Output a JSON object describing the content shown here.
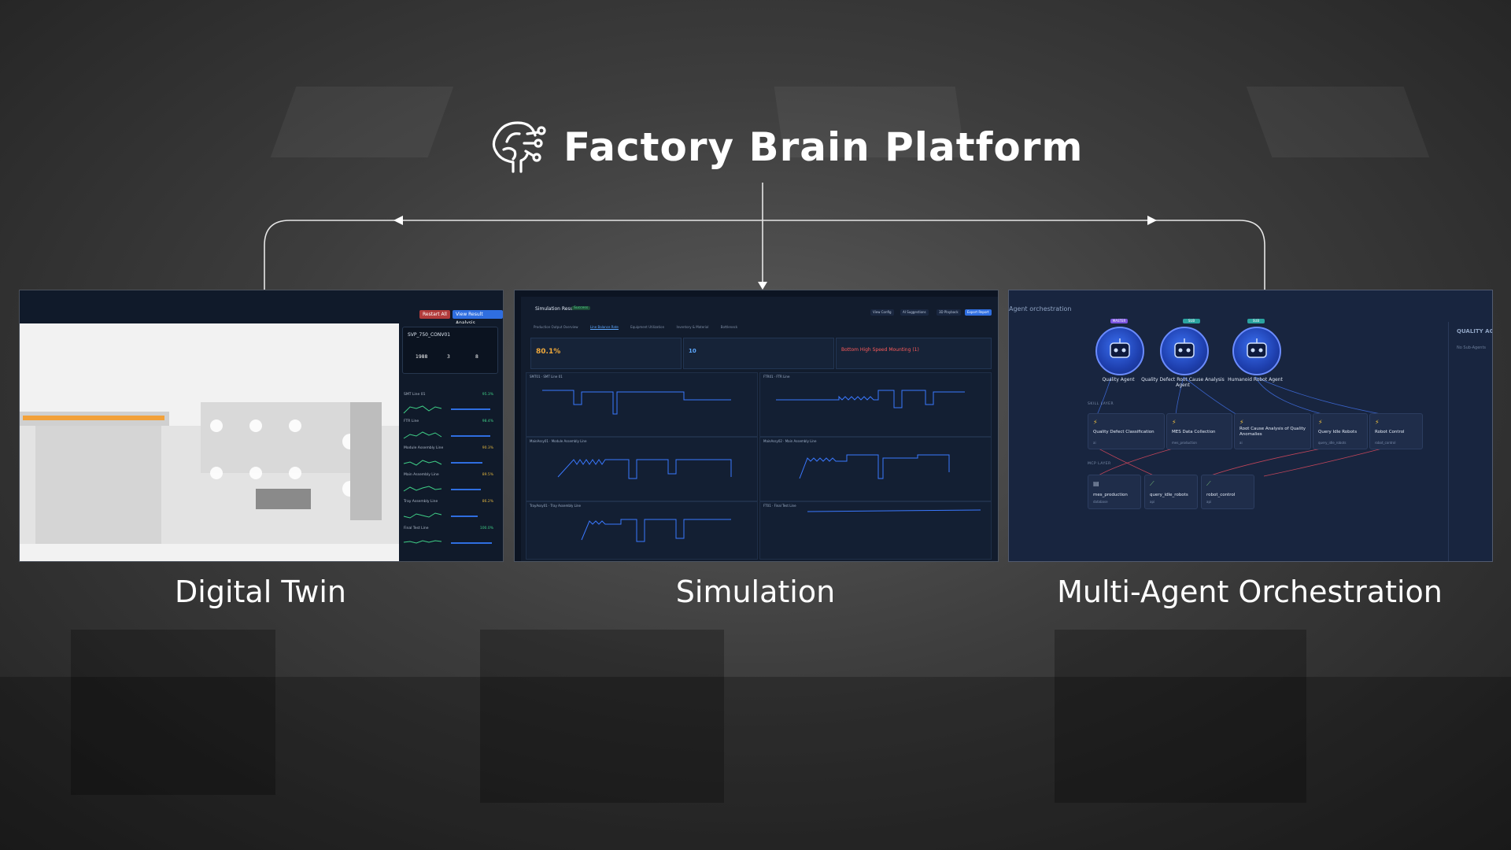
{
  "page": {
    "title": "Factory Brain Platform"
  },
  "panels": {
    "twin": {
      "label": "Digital Twin",
      "station": "SVP_750_CONV01",
      "card_values": [
        "1988",
        "3",
        "8"
      ],
      "lines": [
        {
          "name": "SMT Line 01",
          "pct": "95.3%",
          "status_color": "#3fcf87"
        },
        {
          "name": "FTR Line",
          "pct": "98.4%",
          "status_color": "#3fcf87"
        },
        {
          "name": "Module Assembly Line",
          "pct": "90.3%",
          "status_color": "#e0b43f"
        },
        {
          "name": "Main Assembly Line",
          "pct": "89.5%",
          "status_color": "#e0b43f"
        },
        {
          "name": "Tray Assembly Line",
          "pct": "86.2%",
          "status_color": "#e0b43f"
        },
        {
          "name": "Final Test Line",
          "pct": "100.0%",
          "status_color": "#3fcf87"
        }
      ],
      "topbar": {
        "restart": "Restart All",
        "view": "View Result Analysis"
      }
    },
    "sim": {
      "label": "Simulation",
      "result_title": "Simulation Result",
      "status": "Success",
      "tabs": [
        "Production Output Overview",
        "Line Balance Rate",
        "Equipment Utilization",
        "Inventory & Material",
        "Bottleneck"
      ],
      "kpi_value": "80.1%",
      "kpi_secondary": "10",
      "alert": "Bottom High Speed Mounting (1)",
      "buttons": [
        "View Config",
        "AI Suggestions",
        "3D Playback",
        "Export Report"
      ],
      "charts": [
        "SMT01 · SMT Line 01",
        "FTR01 · FTR Line",
        "MainAssy01 · Module Assembly Line",
        "MainAssy02 · Main Assembly Line",
        "TrayAssy01 · Tray Assembly Line",
        "FT01 · Final Test Line"
      ]
    },
    "agent": {
      "label": "Multi-Agent Orchestration",
      "header": "Agent orchestration",
      "right_column": "QUALITY AGENT",
      "right_column_sub": "No Sub-Agents",
      "agents": [
        {
          "name": "Quality Agent",
          "badge": "MASTER",
          "badge_color": "#7b55e0"
        },
        {
          "name": "Quality Defect Root Cause Analysis Agent",
          "badge": "SUB",
          "badge_color": "#2ba3a0"
        },
        {
          "name": "Humanoid Robot Agent",
          "badge": "SUB",
          "badge_color": "#2ba3a0"
        }
      ],
      "skill_label": "SKILL LAYER",
      "skills": [
        {
          "title": "Quality Defect Classification",
          "sub": "ai"
        },
        {
          "title": "MES Data Collection",
          "sub": "mes_production"
        },
        {
          "title": "Root Cause Analysis of Quality Anomalies",
          "sub": "ai"
        },
        {
          "title": "Query Idle Robots",
          "sub": "query_idle_robots"
        },
        {
          "title": "Robot Control",
          "sub": "robot_control"
        }
      ],
      "mcp_label": "MCP LAYER",
      "mcps": [
        {
          "title": "mes_production",
          "sub": "database"
        },
        {
          "title": "query_idle_robots",
          "sub": "api"
        },
        {
          "title": "robot_control",
          "sub": "api"
        }
      ]
    }
  }
}
